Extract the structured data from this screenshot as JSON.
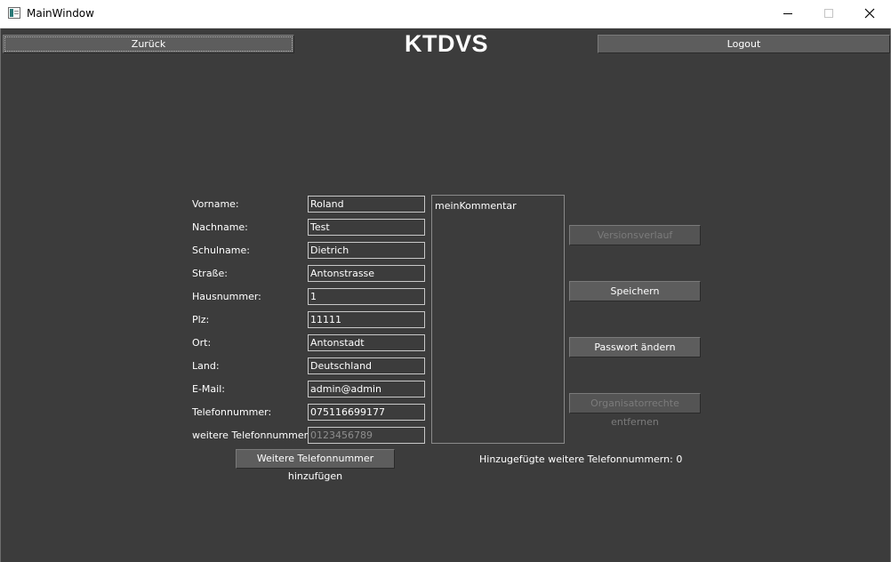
{
  "window": {
    "title": "MainWindow",
    "controls": {
      "minimize": "minimize-icon",
      "maximize": "maximize-icon",
      "close": "close-icon"
    }
  },
  "header": {
    "back_label": "Zurück",
    "app_title": "KTDVS",
    "logout_label": "Logout"
  },
  "form": {
    "fields": [
      {
        "label": "Vorname:",
        "value": "Roland",
        "placeholder": ""
      },
      {
        "label": "Nachname:",
        "value": "Test",
        "placeholder": ""
      },
      {
        "label": "Schulname:",
        "value": "Dietrich",
        "placeholder": ""
      },
      {
        "label": "Straße:",
        "value": "Antonstrasse",
        "placeholder": ""
      },
      {
        "label": "Hausnummer:",
        "value": "1",
        "placeholder": ""
      },
      {
        "label": "Plz:",
        "value": "11111",
        "placeholder": ""
      },
      {
        "label": "Ort:",
        "value": "Antonstadt",
        "placeholder": ""
      },
      {
        "label": "Land:",
        "value": "Deutschland",
        "placeholder": ""
      },
      {
        "label": "E-Mail:",
        "value": "admin@admin",
        "placeholder": ""
      },
      {
        "label": "Telefonnummer:",
        "value": "075116699177",
        "placeholder": ""
      },
      {
        "label": "weitere Telefonnummern:",
        "value": "",
        "placeholder": "0123456789"
      }
    ],
    "comment": "meinKommentar",
    "add_phone_label": "Weitere Telefonnummer hinzufügen",
    "added_phones_label": "Hinzugefügte weitere Telefonnummern:",
    "added_phones_count": "0"
  },
  "actions": {
    "version_history_label": "Versionsverlauf",
    "save_label": "Speichern",
    "change_password_label": "Passwort ändern",
    "remove_organizer_label": "Organisatorrechte entfernen"
  },
  "colors": {
    "background": "#3c3c3c",
    "button": "#5d5d5d",
    "text": "#ffffff",
    "disabled_text": "#7b7b7b"
  }
}
